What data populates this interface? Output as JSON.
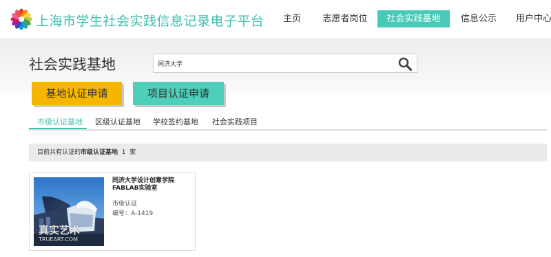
{
  "header": {
    "site_title": "上海市学生社会实践信息记录电子平台",
    "nav": [
      {
        "label": "主页",
        "active": false
      },
      {
        "label": "志愿者岗位",
        "active": false
      },
      {
        "label": "社会实践基地",
        "active": true
      },
      {
        "label": "信息公示",
        "active": false
      },
      {
        "label": "用户中心",
        "active": false
      }
    ]
  },
  "main": {
    "page_title": "社会实践基地",
    "search": {
      "value": "同济大学",
      "icon": "search-icon"
    },
    "apply_base_label": "基地认证申请",
    "apply_project_label": "项目认证申请",
    "tabs": [
      {
        "label": "市级认证基地",
        "active": true
      },
      {
        "label": "区级认证基地",
        "active": false
      },
      {
        "label": "学校签约基地",
        "active": false
      },
      {
        "label": "社会实践项目",
        "active": false
      }
    ],
    "info": {
      "prefix": "目前共有认证的",
      "category": "市级认证基地",
      "count": "1",
      "unit": "家"
    },
    "cards": [
      {
        "title_line1": "同济大学设计创意学院",
        "title_line2": "FABLAB实验室",
        "level": "市级认证",
        "number_label": "编号",
        "number_sep": "：",
        "number": "A-1419"
      }
    ]
  },
  "watermark": {
    "main": "真实艺术",
    "sub": "TRUEART.COM"
  },
  "colors": {
    "accent": "#49c9b7",
    "brand_text": "#3fbfae",
    "yellow": "#f7b500",
    "teal_button": "#4ecfb9"
  }
}
